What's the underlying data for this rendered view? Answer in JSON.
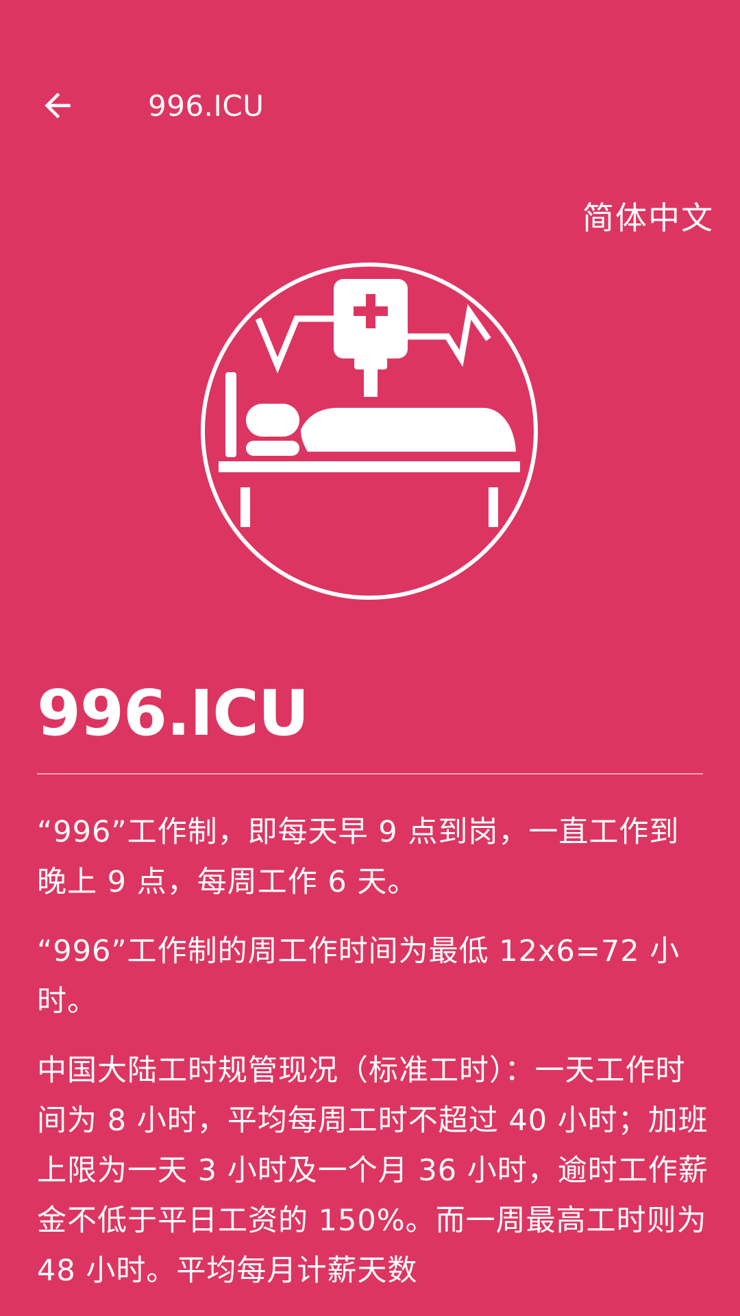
{
  "app_bar": {
    "title": "996.ICU",
    "back_icon": "arrow-left-icon"
  },
  "language": {
    "label": "简体中文"
  },
  "logo": {
    "icon": "icu-bed-iv-logo-icon"
  },
  "main": {
    "title": "996.ICU",
    "paragraphs": [
      "“996”工作制，即每天早 9 点到岗，一直工作到晚上 9 点，每周工作 6 天。",
      "“996”工作制的周工作时间为最低 12x6=72 小时。",
      "中国大陆工时规管现况（标准工时）：一天工作时间为 8 小时，平均每周工时不超过 40 小时；加班上限为一天 3 小时及一个月 36 小时，逾时工作薪金不低于平日工资的 150%。而一周最高工时则为 48 小时。平均每月计薪天数"
    ]
  },
  "colors": {
    "background": "#DD3561",
    "foreground": "#FFFFFF"
  }
}
